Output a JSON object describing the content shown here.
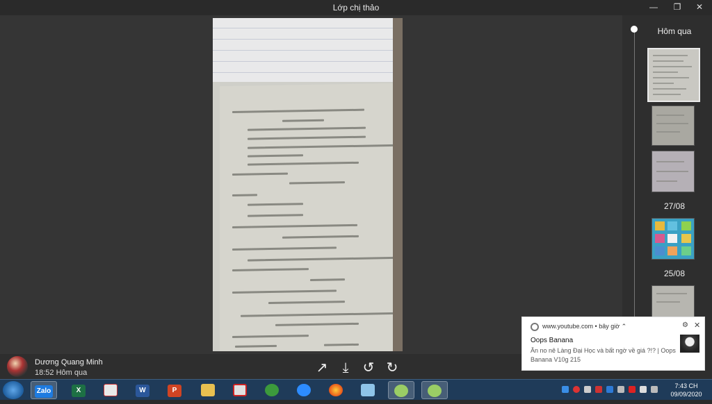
{
  "window": {
    "title": "Lớp chị thảo",
    "minimize_icon": "minimize-icon",
    "maximize_icon": "restore-icon",
    "close_icon": "close-icon"
  },
  "sender": {
    "name": "Dương Quang Minh",
    "time": "18:52 Hôm qua"
  },
  "controls": {
    "share_icon": "share-icon",
    "download_icon": "download-icon",
    "rotate_left_icon": "rotate-left-icon",
    "rotate_right_icon": "rotate-right-icon"
  },
  "sidebar": {
    "groups": [
      {
        "label": "Hôm qua"
      },
      {
        "label": "27/08"
      },
      {
        "label": "25/08"
      }
    ]
  },
  "notification": {
    "source": "www.youtube.com",
    "when": "bây giờ",
    "title": "Oops Banana",
    "body": "Ăn no nê Làng Đại Học và bất ngờ về giá ?!? | Oops Banana V10g 215"
  },
  "taskbar": {
    "apps": [
      {
        "name": "zalo",
        "label": "Zalo"
      },
      {
        "name": "excel",
        "label": "X"
      },
      {
        "name": "paint",
        "label": ""
      },
      {
        "name": "word",
        "label": "W"
      },
      {
        "name": "powerpoint",
        "label": "P"
      },
      {
        "name": "file-explorer",
        "label": ""
      },
      {
        "name": "app-red",
        "label": ""
      },
      {
        "name": "app-green",
        "label": ""
      },
      {
        "name": "zoom",
        "label": ""
      },
      {
        "name": "firefox",
        "label": ""
      },
      {
        "name": "notepad",
        "label": ""
      },
      {
        "name": "app-geogebra",
        "label": ""
      },
      {
        "name": "app-geogebra-2",
        "label": ""
      }
    ],
    "clock_time": "7:43 CH",
    "clock_date": "09/09/2020"
  },
  "colors": {
    "taskbar": "#1f3b59",
    "viewer_bg": "#353535",
    "toast_bg": "#ffffff"
  }
}
